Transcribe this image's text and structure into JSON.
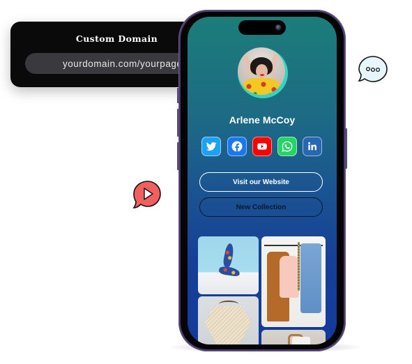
{
  "domain_card": {
    "title": "Custom Domain",
    "input_value": "yourdomain.com/yourpage",
    "background": "#0a0a0a"
  },
  "profile": {
    "name": "Arlene McCoy",
    "avatar_ring_color": "#35d3c2"
  },
  "socials": [
    {
      "name": "twitter",
      "icon": "twitter-icon",
      "color": "#1da1f2"
    },
    {
      "name": "facebook",
      "icon": "facebook-icon",
      "color": "#1877f2"
    },
    {
      "name": "youtube",
      "icon": "youtube-icon",
      "color": "#ff0000"
    },
    {
      "name": "whatsapp",
      "icon": "whatsapp-icon",
      "color": "#25d366"
    },
    {
      "name": "linkedin",
      "icon": "linkedin-icon",
      "color": "#2867b2"
    }
  ],
  "buttons": {
    "visit_website": "Visit our Website",
    "new_collection": "New Collection"
  },
  "gallery": [
    {
      "subject": "shoes"
    },
    {
      "subject": "clothing-rack"
    },
    {
      "subject": "poncho"
    },
    {
      "subject": "chair"
    }
  ],
  "decorations": {
    "chat_bubble_color": "#e6f6fb",
    "play_bubble_color": "#f25f5f"
  }
}
